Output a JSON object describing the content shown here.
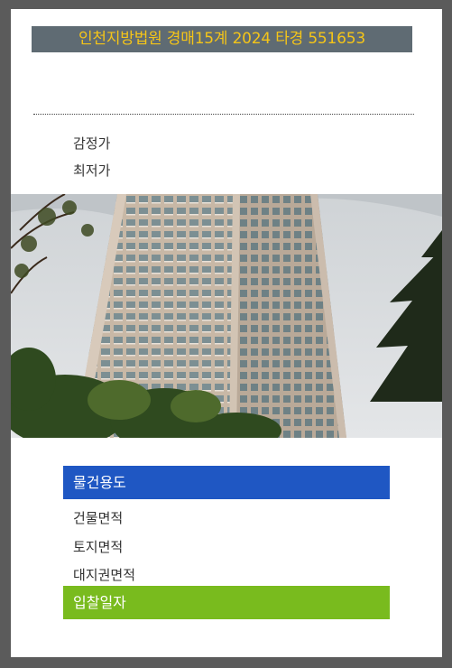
{
  "header": {
    "title": "인천지방법원 경매15계 2024 타경 551653"
  },
  "price_rows": {
    "appraisal_label": "감정가",
    "minimum_label": "최저가"
  },
  "photo": {
    "subject": "high-rise apartment tower photo"
  },
  "details": {
    "usage_label": "물건용도",
    "building_area_label": "건물면적",
    "land_area_label": "토지면적",
    "land_share_area_label": "대지권면적",
    "bid_date_label": "입찰일자"
  },
  "colors": {
    "background": "#5b5b5b",
    "title_bar": "#5f6b73",
    "title_text": "#f5c518",
    "usage_banner": "#1f57c3",
    "bid_banner": "#79bb1e"
  }
}
